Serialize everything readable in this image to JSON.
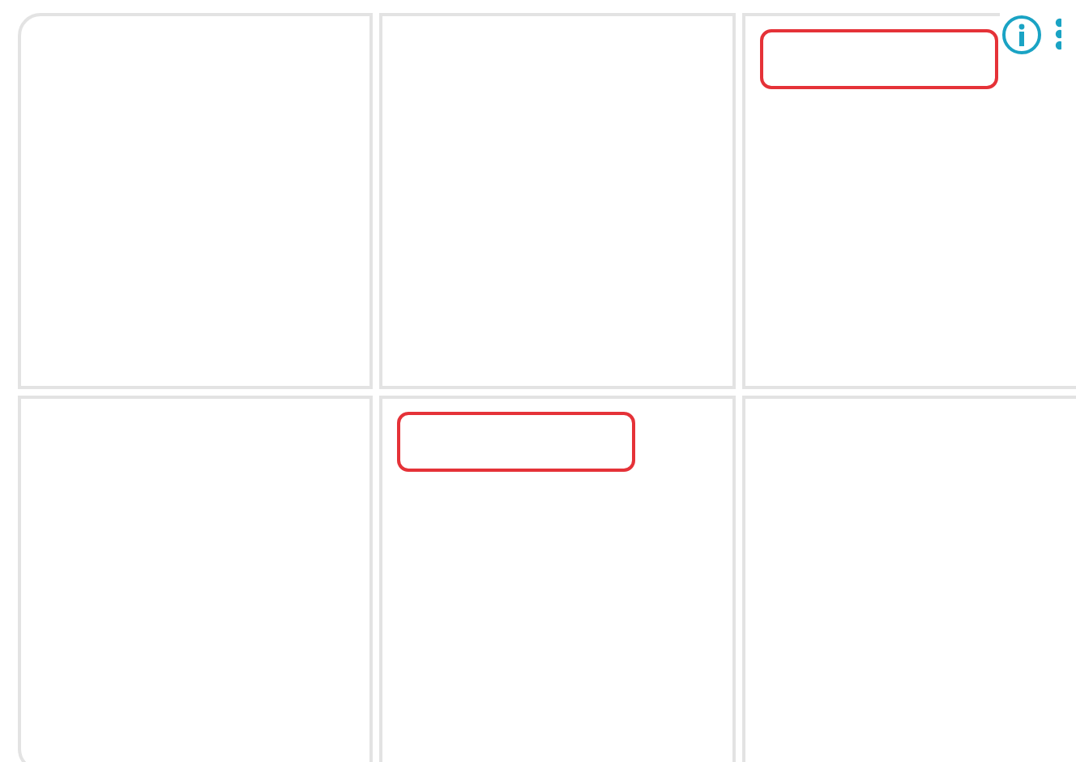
{
  "cells": [
    {
      "marked": false
    },
    {
      "marked": false
    },
    {
      "marked": true
    },
    {
      "marked": false
    },
    {
      "marked": true
    },
    {
      "marked": false
    }
  ]
}
